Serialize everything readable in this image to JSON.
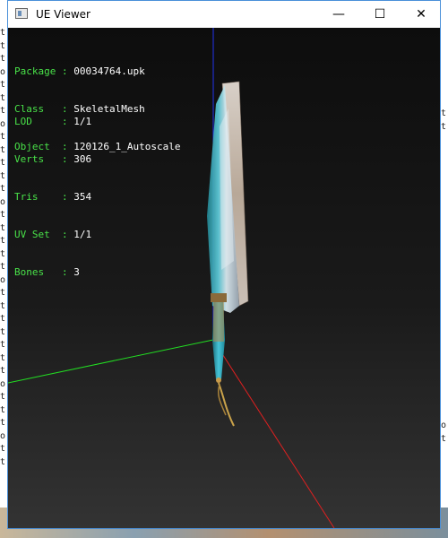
{
  "window": {
    "title": "UE Viewer",
    "controls": {
      "minimize": "—",
      "maximize": "☐",
      "close": "✕"
    }
  },
  "object_info": [
    {
      "key": "Package",
      "sep": " : ",
      "value": "00034764.upk"
    },
    {
      "key": "Class  ",
      "sep": " : ",
      "value": "SkeletalMesh"
    },
    {
      "key": "Object ",
      "sep": " : ",
      "value": "120126_1_Autoscale"
    }
  ],
  "mesh_stats": [
    {
      "key": "LOD    ",
      "sep": " : ",
      "value": "1/1"
    },
    {
      "key": "Verts  ",
      "sep": " : ",
      "value": "306"
    },
    {
      "key": "Tris   ",
      "sep": " : ",
      "value": "354"
    },
    {
      "key": "UV Set ",
      "sep": " : ",
      "value": "1/1"
    },
    {
      "key": "Bones  ",
      "sep": " : ",
      "value": "3"
    }
  ],
  "background_text": {
    "left": "t\nt\nt\no\nt\nt\nt\no\nt\nt\nt\nt\nt\no\nt\nt\nt\nt\nt\no\nt\nt\nt\nt\nt\nt\nt\no\nt\nt\nt\no\nt\nt",
    "right": "t\nt\n \n \n \n \n \n \n \n \n \n \n \n \n \n \n \n \n \n \n \n \n \n \no\nt"
  },
  "colors": {
    "label": "#49e249",
    "value": "#ffffff",
    "axis_x": "#e02020",
    "axis_y": "#22dd22",
    "axis_z": "#2233ee"
  }
}
